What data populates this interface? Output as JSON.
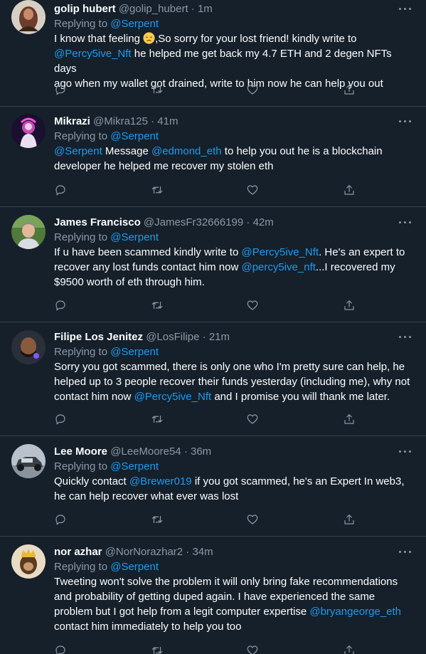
{
  "colors": {
    "background": "#15202b",
    "divider": "#38444d",
    "secondary_text": "#8b98a5",
    "link": "#1d9bf0",
    "primary_text": "#ffffff"
  },
  "tweets": [
    {
      "display_name": "golip hubert",
      "handle": "@golip_hubert",
      "time": "1m",
      "replying_label": "Replying to",
      "replying_to": "@Serpent",
      "text_1": "I know that feeling ",
      "emoji": "disappointed-face",
      "text_2": ",So sorry for your lost friend! kindly write to",
      "mention_1": "@Percy5ive_Nft",
      "text_3": " he helped me get back my 4.7 ETH and 2 degen NFTs days",
      "text_4": "ago when my wallet got drained, write to him now he can help you out"
    },
    {
      "display_name": "Mikrazi",
      "handle": "@Mikra125",
      "time": "41m",
      "replying_label": "Replying to",
      "replying_to": "@Serpent",
      "mention_1": "@Serpent",
      "text_1": " Message ",
      "mention_2": "@edmond_eth",
      "text_2": " to help you out he is a blockchain",
      "text_3": "developer he helped me recover my stolen eth"
    },
    {
      "display_name": "James Francisco",
      "handle": "@JamesFr32666199",
      "time": "42m",
      "replying_label": "Replying to",
      "replying_to": "@Serpent",
      "text_1": "If u have been scammed kindly write to ",
      "mention_1": "@Percy5ive_Nft",
      "text_2": ".  He's an expert to",
      "text_3": "recover any lost funds contact him now ",
      "mention_2": "@percy5ive_nft",
      "text_4": "...I recovered my",
      "text_5": "$9500 worth of eth through him."
    },
    {
      "display_name": "Filipe Los Jenitez",
      "handle": "@LosFilipe",
      "time": "21m",
      "replying_label": "Replying to",
      "replying_to": "@Serpent",
      "text_1": "Sorry you got scammed, there is only one who I'm pretty sure can help, he",
      "text_2": "helped up to 3 people recover their funds yesterday (including me), why not",
      "text_3": "contact him now ",
      "mention_1": "@Percy5ive_Nft",
      "text_4": " and I promise you will thank me later."
    },
    {
      "display_name": "Lee Moore",
      "handle": "@LeeMoore54",
      "time": "36m",
      "replying_label": "Replying to",
      "replying_to": "@Serpent",
      "text_1": "Quickly contact ",
      "mention_1": "@Brewer019",
      "text_2": " if you got scammed, he's an Expert In web3,",
      "text_3": "he can help recover what ever was lost"
    },
    {
      "display_name": "nor azhar",
      "handle": "@NorNorazhar2",
      "time": "34m",
      "replying_label": "Replying to",
      "replying_to": "@Serpent",
      "text_1": "Tweeting won't solve the problem it will only bring fake recommendations",
      "text_2": "and probability of getting duped again. I have experienced the same",
      "text_3": "problem but I got help from a legit computer expertise ",
      "mention_1": "@bryangeorge_eth",
      "text_4": "contact him immediately to help you too"
    }
  ],
  "separator": "·",
  "action_icons": [
    "reply-icon",
    "retweet-icon",
    "like-icon",
    "share-icon"
  ],
  "more_icon": "more-options-icon"
}
